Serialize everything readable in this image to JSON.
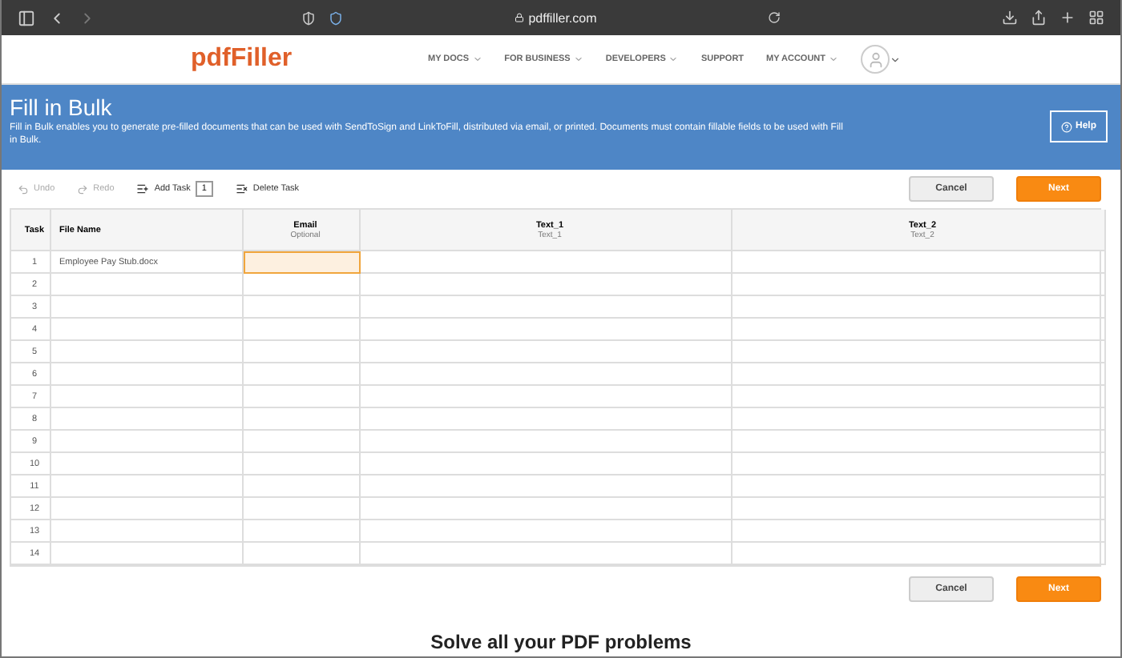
{
  "browser": {
    "address": "pdffiller.com"
  },
  "nav": {
    "logo": "pdfFiller",
    "items": [
      {
        "label": "MY DOCS",
        "dropdown": true
      },
      {
        "label": "FOR BUSINESS",
        "dropdown": true
      },
      {
        "label": "DEVELOPERS",
        "dropdown": true
      },
      {
        "label": "SUPPORT",
        "dropdown": false
      },
      {
        "label": "MY ACCOUNT",
        "dropdown": true
      }
    ]
  },
  "banner": {
    "title": "Fill in Bulk",
    "description": "Fill in Bulk enables you to generate pre-filled documents that can be used with SendToSign and LinkToFill, distributed via email, or printed. Documents must contain fillable fields to be used with Fill in Bulk.",
    "help": "Help"
  },
  "toolbar": {
    "undo": {
      "label": "Undo",
      "disabled": true
    },
    "redo": {
      "label": "Redo",
      "disabled": true
    },
    "add_task": "Add Task",
    "add_count": "1",
    "delete_task": "Delete Task",
    "cancel": "Cancel",
    "next": "Next"
  },
  "table": {
    "columns": [
      {
        "title": "Task"
      },
      {
        "title": "File Name"
      },
      {
        "title": "Email",
        "subtitle": "Optional"
      },
      {
        "title": "Text_1",
        "subtitle": "Text_1"
      },
      {
        "title": "Text_2",
        "subtitle": "Text_2"
      }
    ],
    "rows": [
      {
        "task": "1",
        "file_name": "Employee Pay Stub.docx",
        "email_selected": true
      },
      {
        "task": "2",
        "email_selected": false
      },
      {
        "task": "3",
        "email_selected": false
      },
      {
        "task": "4",
        "email_selected": false
      },
      {
        "task": "5",
        "email_selected": false
      },
      {
        "task": "6",
        "email_selected": false
      },
      {
        "task": "7",
        "email_selected": false
      },
      {
        "task": "8",
        "email_selected": false
      },
      {
        "task": "9",
        "email_selected": false
      },
      {
        "task": "10",
        "email_selected": false
      },
      {
        "task": "11",
        "email_selected": false
      },
      {
        "task": "12",
        "email_selected": false
      },
      {
        "task": "13",
        "email_selected": false
      },
      {
        "task": "14",
        "email_selected": false
      }
    ]
  },
  "footer": {
    "cancel": "Cancel",
    "next": "Next",
    "heading": "Solve all your PDF problems"
  }
}
